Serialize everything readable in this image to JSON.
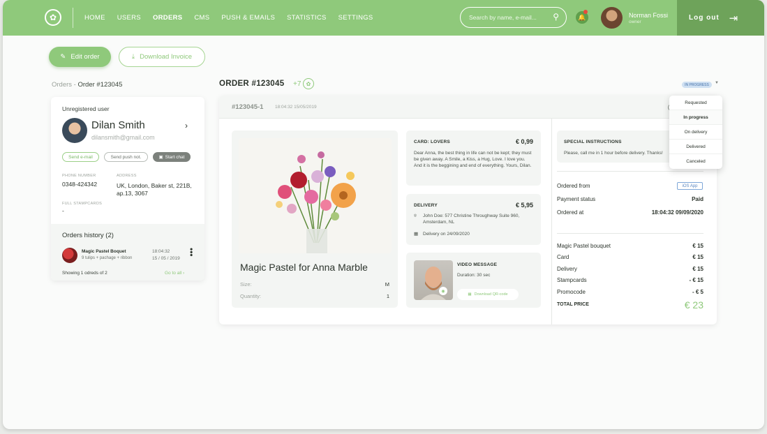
{
  "nav": {
    "items": [
      "HOME",
      "USERS",
      "ORDERS",
      "CMS",
      "PUSH & EMAILS",
      "STATISTICS",
      "SETTINGS"
    ],
    "active": "ORDERS",
    "search_placeholder": "Search by name, e-mail...",
    "user_name": "Norman Fossi",
    "user_role": "owner",
    "logout_label": "Log out"
  },
  "actions": {
    "edit_label": "Edit order",
    "download_label": "Download Invoice"
  },
  "breadcrumb": {
    "root": "Orders",
    "separator": " - ",
    "current": "Order #123045"
  },
  "customer": {
    "type": "Unregistered user",
    "name": "Dilan Smith",
    "email": "dilansmith@gmail.com",
    "buttons": {
      "email": "Send e-mail",
      "push": "Send push not.",
      "chat": "Start chat"
    },
    "phone_label": "PHONE NUMBER",
    "phone": "0348-424342",
    "address_label": "ADDRESS",
    "address_line1": "UK, London, Baker st, 221B,",
    "address_line2": "ap.13, 3067",
    "stampcards_label": "FULL STAMPCARDS",
    "stampcards": "-"
  },
  "history": {
    "title": "Orders history (2)",
    "item_name": "Magic Pastel Boquet",
    "item_desc": "9 tulips + pachage + ribbon",
    "item_time": "18:04:32",
    "item_date": "15 / 05 / 2019",
    "showing": "Showing 1 odreds of 2",
    "goto": "Go to all"
  },
  "order": {
    "title": "ORDER #123045",
    "plus": "+7",
    "status": "IN PROGRESS",
    "sub_id": "#123045-1",
    "sub_date": "18:04:32 15/05/2019"
  },
  "product": {
    "name": "Magic Pastel for Anna Marble",
    "size_label": "Size:",
    "size": "M",
    "qty_label": "Quantity:",
    "qty": "1"
  },
  "card_box": {
    "label": "CARD: LOVERS",
    "price": "€ 0,99",
    "text": "Dear Anna, the best thing in life can not be kept; they must be given away.  A Smile, a Kiss, a Hug, Love. I love you. And it is the beggining and end of everything. Yours, Dilan."
  },
  "delivery_box": {
    "label": "DELIVERY",
    "price": "€ 5,95",
    "address": "John Doe: 577 Christine Throughway Suite 960, Amsterdam, NL",
    "date": "Delivery on 24/09/2020"
  },
  "video_box": {
    "label": "VIDEO MESSAGE",
    "duration": "Duration: 30 sec",
    "download": "Download QR-code"
  },
  "special": {
    "label": "SPECIAL INSTRUCTIONS",
    "text": "Please, call me in 1 hour before delivery. Thanks!"
  },
  "summary": {
    "ordered_from_label": "Ordered from",
    "ordered_from": "iOS App",
    "payment_label": "Payment status",
    "payment": "Paid",
    "ordered_at_label": "Ordered at",
    "ordered_at": "18:04:32 09/09/2020",
    "lines": [
      {
        "label": "Magic Pastel bouquet",
        "value": "€ 15"
      },
      {
        "label": "Card",
        "value": "€ 15"
      },
      {
        "label": "Delivery",
        "value": "€ 15"
      },
      {
        "label": "Stampcards",
        "value": "- € 15"
      },
      {
        "label": "Promocode",
        "value": "- € 5"
      }
    ],
    "total_label": "TOTAL PRICE",
    "total": "€ 23"
  },
  "status_menu": {
    "options": [
      "Requested",
      "In progress",
      "On delivery",
      "Delivered",
      "Canceled"
    ],
    "selected": "In progress"
  },
  "colors": {
    "brand": "#8fc97b",
    "brand_dark": "#6ea35a",
    "status_bg": "#cfe0f2"
  }
}
